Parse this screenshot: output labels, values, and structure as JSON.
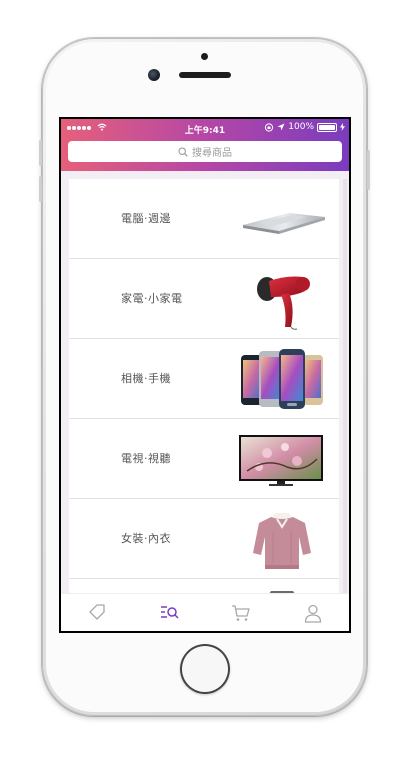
{
  "status_bar": {
    "time": "上午9:41",
    "battery": "100%",
    "battery_level": 1.0
  },
  "search": {
    "placeholder": "搜尋商品",
    "icon": "search-icon"
  },
  "categories": [
    {
      "label": "電腦·週邊",
      "image": "laptop"
    },
    {
      "label": "家電·小家電",
      "image": "hair-dryer"
    },
    {
      "label": "相機·手機",
      "image": "smartphones"
    },
    {
      "label": "電視·視聽",
      "image": "television"
    },
    {
      "label": "女裝·內衣",
      "image": "sweater"
    }
  ],
  "tab_bar": {
    "tabs": [
      {
        "icon": "tag-icon",
        "active": false
      },
      {
        "icon": "category-search-icon",
        "active": true
      },
      {
        "icon": "cart-icon",
        "active": false
      },
      {
        "icon": "user-icon",
        "active": false
      }
    ],
    "active_color": "#7a3cbe",
    "inactive_color": "#a8a8a8"
  },
  "colors": {
    "header_gradient_start": "#e6607a",
    "header_gradient_end": "#7a3cbe"
  }
}
